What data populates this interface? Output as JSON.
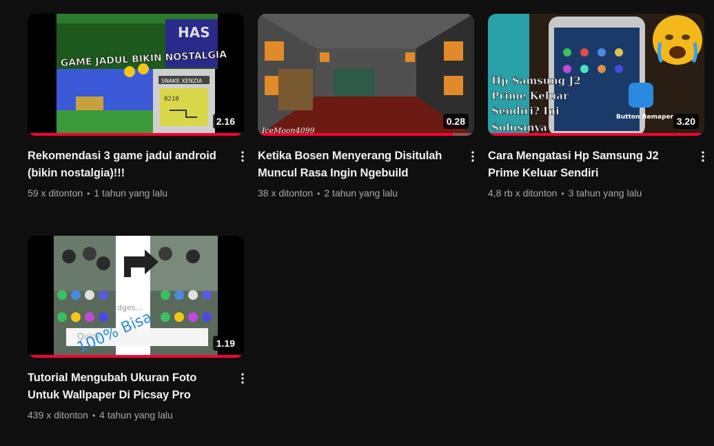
{
  "videos": [
    {
      "title": "Rekomendasi 3 game jadul android (bikin nostalgia)!!!",
      "views": "59 x ditonton",
      "age": "1 tahun yang lalu",
      "duration": "2.16",
      "watched_fraction": 0.98,
      "thumb_texts": [
        "GAME JADUL BIKIN NOSTALGIA",
        "SNAKE XENZIA",
        "0210",
        "HAS"
      ]
    },
    {
      "title": "Ketika Bosen Menyerang Disitulah Muncul Rasa Ingin Ngebuild",
      "views": "38 x ditonton",
      "age": "2 tahun yang lalu",
      "duration": "0.28",
      "watched_fraction": 0.9,
      "thumb_texts": [
        "IceMoon4099"
      ]
    },
    {
      "title": "Cara Mengatasi Hp Samsung J2 Prime Keluar Sendiri",
      "views": "4,8 rb x ditonton",
      "age": "3 tahun yang lalu",
      "duration": "3.20",
      "watched_fraction": 1.0,
      "thumb_texts": [
        "Hp Samsung J2",
        "Prime Keluar",
        "Sendiri? Ini",
        "Solusinya",
        "Button Remaper"
      ]
    },
    {
      "title": "Tutorial Mengubah Ukuran Foto Untuk Wallpaper Di Picsay Pro",
      "views": "439 x ditonton",
      "age": "4 tahun yang lalu",
      "duration": "1.19",
      "watched_fraction": 1.0,
      "thumb_texts": [
        "100% Bisa",
        "Quick",
        "dges..."
      ]
    }
  ],
  "separator": "•",
  "icons": {
    "menu": "more-vert-icon"
  },
  "colors": {
    "progress": "#ff0033",
    "background": "#0f0f0f",
    "secondary_text": "#aaaaaa"
  }
}
